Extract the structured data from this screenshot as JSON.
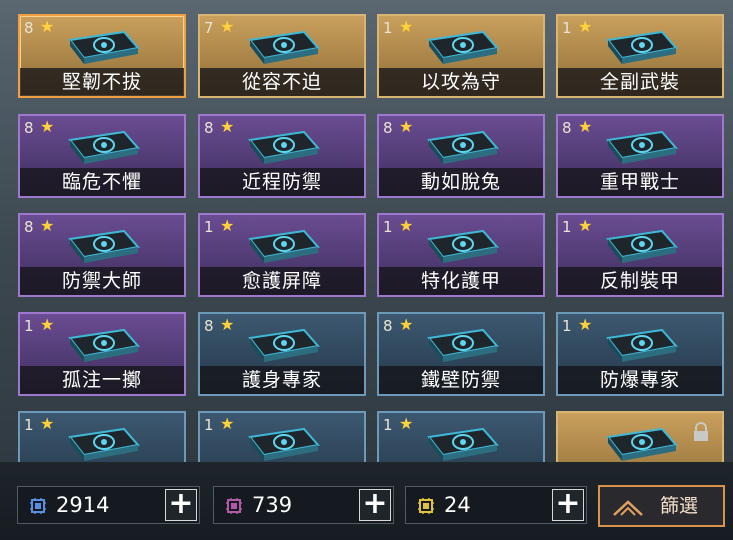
{
  "cards": [
    {
      "name": "堅韌不拔",
      "count": "8",
      "rarity": "gold",
      "selected": true
    },
    {
      "name": "從容不迫",
      "count": "7",
      "rarity": "gold"
    },
    {
      "name": "以攻為守",
      "count": "1",
      "rarity": "gold"
    },
    {
      "name": "全副武裝",
      "count": "1",
      "rarity": "gold"
    },
    {
      "name": "臨危不懼",
      "count": "8",
      "rarity": "purple"
    },
    {
      "name": "近程防禦",
      "count": "8",
      "rarity": "purple"
    },
    {
      "name": "動如脫兔",
      "count": "8",
      "rarity": "purple"
    },
    {
      "name": "重甲戰士",
      "count": "8",
      "rarity": "purple"
    },
    {
      "name": "防禦大師",
      "count": "8",
      "rarity": "purple"
    },
    {
      "name": "愈護屏障",
      "count": "1",
      "rarity": "purple"
    },
    {
      "name": "特化護甲",
      "count": "1",
      "rarity": "purple"
    },
    {
      "name": "反制裝甲",
      "count": "1",
      "rarity": "purple"
    },
    {
      "name": "孤注一擲",
      "count": "1",
      "rarity": "purple"
    },
    {
      "name": "護身專家",
      "count": "8",
      "rarity": "blue"
    },
    {
      "name": "鐵壁防禦",
      "count": "8",
      "rarity": "blue"
    },
    {
      "name": "防爆專家",
      "count": "1",
      "rarity": "blue"
    },
    {
      "name": "",
      "count": "1",
      "rarity": "blue"
    },
    {
      "name": "",
      "count": "1",
      "rarity": "blue"
    },
    {
      "name": "",
      "count": "1",
      "rarity": "blue"
    },
    {
      "name": "",
      "count": "",
      "rarity": "gold",
      "locked": true
    }
  ],
  "resources": [
    {
      "value": "2914",
      "color": "#5a8fe0",
      "icon": "blue-chip-icon"
    },
    {
      "value": "739",
      "color": "#b05aa8",
      "icon": "purple-chip-icon"
    },
    {
      "value": "24",
      "color": "#e0c040",
      "icon": "gold-chip-icon"
    }
  ],
  "plus_label": "+",
  "star_glyph": "★",
  "filter_label": "篩選",
  "colors": {
    "gold": "#d9b574",
    "purple": "#9d78cc",
    "blue": "#6d9ab8",
    "accent": "#f0a040"
  }
}
